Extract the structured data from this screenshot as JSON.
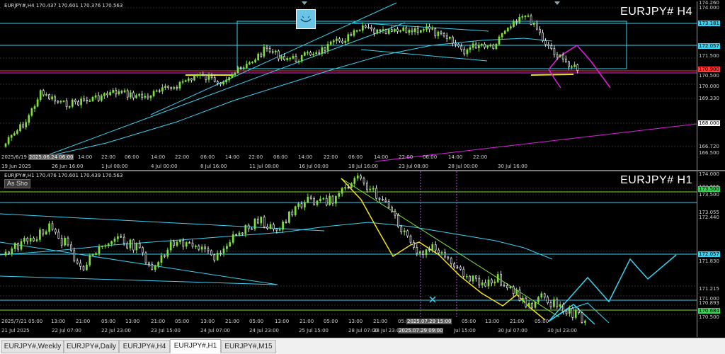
{
  "h4": {
    "info": "EURJPY#,H4  170.437 170.601 170.376 170.563",
    "big_title": "EURJPY#  H4",
    "price_labels": [
      {
        "text": "174.260",
        "bg": ""
      },
      {
        "text": "174.000",
        "bg": ""
      },
      {
        "text": "173.181",
        "bg": "#3ad1f2"
      },
      {
        "text": "172.057",
        "bg": "#3ad1f2"
      },
      {
        "text": "171.500",
        "bg": ""
      },
      {
        "text": "170.900",
        "bg": "#ff3b3b"
      },
      {
        "text": "170.500",
        "bg": ""
      },
      {
        "text": "170.000",
        "bg": ""
      },
      {
        "text": "169.330",
        "bg": ""
      },
      {
        "text": "168.000",
        "bg": "#ffffff"
      },
      {
        "text": "166.720",
        "bg": ""
      },
      {
        "text": "166.500",
        "bg": ""
      }
    ],
    "time_labels": [
      {
        "text": "2025/6/19",
        "hl": false
      },
      {
        "text": "2025.06.24 06:00",
        "hl": true
      },
      {
        "text": "14:00",
        "hl": false
      },
      {
        "text": "22:00",
        "hl": false
      },
      {
        "text": "06:00",
        "hl": false
      },
      {
        "text": "14:00",
        "hl": false
      },
      {
        "text": "22:00",
        "hl": false
      },
      {
        "text": "06:00",
        "hl": false
      },
      {
        "text": "14:00",
        "hl": false
      },
      {
        "text": "22:00",
        "hl": false
      },
      {
        "text": "06:00",
        "hl": false
      },
      {
        "text": "14:00",
        "hl": false
      },
      {
        "text": "22:00",
        "hl": false
      },
      {
        "text": "06:00",
        "hl": false
      },
      {
        "text": "14:00",
        "hl": false
      },
      {
        "text": "22:00",
        "hl": false
      },
      {
        "text": "06:00",
        "hl": false
      },
      {
        "text": "14:00",
        "hl": false
      },
      {
        "text": "22:00",
        "hl": false
      }
    ],
    "date_labels": [
      {
        "text": "19 Jun 2025"
      },
      {
        "text": "26 Jun 16:00"
      },
      {
        "text": "1 Jul 08:00"
      },
      {
        "text": "4 Jul 00:00"
      },
      {
        "text": "8 Jul 16:00"
      },
      {
        "text": "11 Jul 08:00"
      },
      {
        "text": "16 Jul 00:00"
      },
      {
        "text": "18 Jul 16:00"
      },
      {
        "text": "23 Jul 08:00"
      },
      {
        "text": "28 Jul 00:00"
      },
      {
        "text": "30 Jul 16:00"
      }
    ]
  },
  "h1": {
    "info": "EURJPY#,H1  170.476 170.601 170.439 170.563",
    "big_title": "EURJPY#  H1",
    "as_show_label": "As Sho",
    "price_labels": [
      {
        "text": "174.000",
        "bg": ""
      },
      {
        "text": "173.655",
        "bg": ""
      },
      {
        "text": "173.500",
        "bg": "#39d353"
      },
      {
        "text": "173.500",
        "bg": ""
      },
      {
        "text": "173.055",
        "bg": ""
      },
      {
        "text": "172.440",
        "bg": ""
      },
      {
        "text": "172.057",
        "bg": "#3ad1f2"
      },
      {
        "text": "171.830",
        "bg": ""
      },
      {
        "text": "171.215",
        "bg": ""
      },
      {
        "text": "171.000",
        "bg": ""
      },
      {
        "text": "170.893",
        "bg": ""
      },
      {
        "text": "170.684",
        "bg": "#39d353"
      },
      {
        "text": "170.500",
        "bg": ""
      }
    ],
    "time_labels": [
      {
        "text": "2025/7/21",
        "hl": false
      },
      {
        "text": "05:00",
        "hl": false
      },
      {
        "text": "13:00",
        "hl": false
      },
      {
        "text": "21:00",
        "hl": false
      },
      {
        "text": "05:00",
        "hl": false
      },
      {
        "text": "13:00",
        "hl": false
      },
      {
        "text": "21:00",
        "hl": false
      },
      {
        "text": "05:00",
        "hl": false
      },
      {
        "text": "13:00",
        "hl": false
      },
      {
        "text": "21:00",
        "hl": false
      },
      {
        "text": "05:00",
        "hl": false
      },
      {
        "text": "13:00",
        "hl": false
      },
      {
        "text": "21:00",
        "hl": false
      },
      {
        "text": "05:00",
        "hl": false
      },
      {
        "text": "13:00",
        "hl": false
      },
      {
        "text": "21:00",
        "hl": false
      },
      {
        "text": "05:00",
        "hl": false
      },
      {
        "text": "2025.07.29 15:00",
        "hl": true
      },
      {
        "text": "05:00",
        "hl": false
      },
      {
        "text": "13:00",
        "hl": false
      },
      {
        "text": "21:00",
        "hl": false
      },
      {
        "text": "05:00",
        "hl": false
      }
    ],
    "date_labels": [
      {
        "text": "21 Jul 2025",
        "hl": false
      },
      {
        "text": "22 Jul 07:00",
        "hl": false
      },
      {
        "text": "22 Jul 23:00",
        "hl": false
      },
      {
        "text": "23 Jul 15:00",
        "hl": false
      },
      {
        "text": "24 Jul 07:00",
        "hl": false
      },
      {
        "text": "24 Jul 23:00",
        "hl": false
      },
      {
        "text": "25 Jul 15:00",
        "hl": false
      },
      {
        "text": "28 Jul 07:00",
        "hl": false
      },
      {
        "text": "28 Jul 23:00",
        "hl": false
      },
      {
        "text": "2025.07.29 09:00",
        "hl": true
      },
      {
        "text": "Jul 15:00",
        "hl": false
      },
      {
        "text": "30 Jul 07:00",
        "hl": false
      },
      {
        "text": "30 Jul 23:00",
        "hl": false
      }
    ]
  },
  "tabs": [
    {
      "label": "EURJPY#,Weekly",
      "active": false
    },
    {
      "label": "EURJPY#,Daily",
      "active": false
    },
    {
      "label": "EURJPY#,H4",
      "active": false
    },
    {
      "label": "EURJPY#,H1",
      "active": true
    },
    {
      "label": "EURJPY#,M15",
      "active": false
    }
  ],
  "colors": {
    "cyan": "#3ad1f2",
    "magenta": "#e020e0",
    "yellow": "#f2e21a",
    "green": "#7ee03a",
    "red": "#ff3b3b",
    "up": "#7ee03a",
    "down": "#e8e8e8"
  }
}
